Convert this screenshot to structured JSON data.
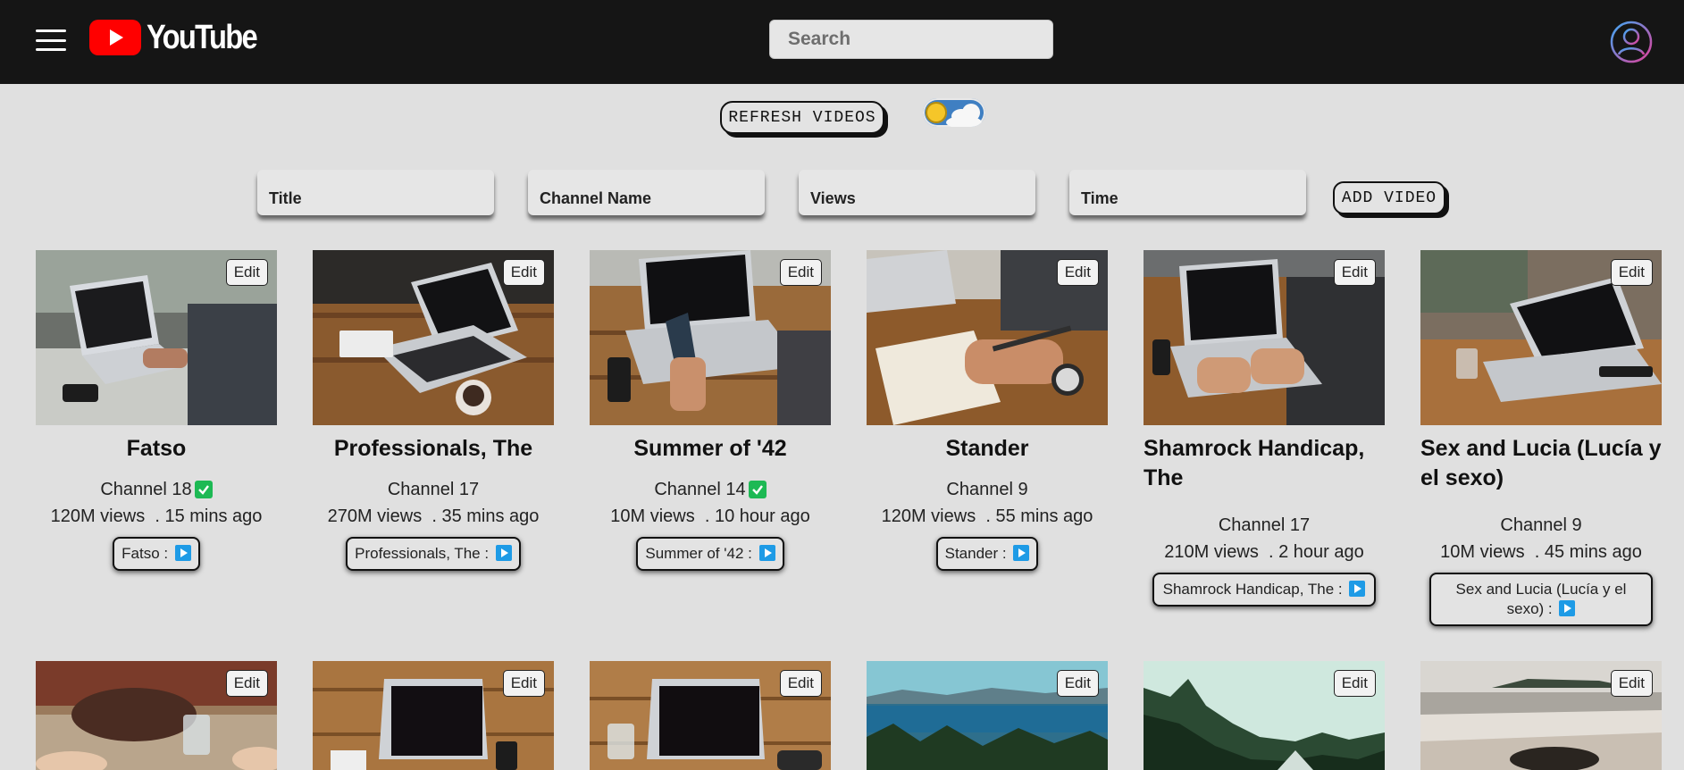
{
  "header": {
    "logo_text": "YouTube",
    "search_placeholder": "Search"
  },
  "controls": {
    "refresh_label": "REFRESH VIDEOS",
    "add_label": "ADD VIDEO",
    "fields": {
      "title_placeholder": "Title",
      "channel_placeholder": "Channel Name",
      "views_placeholder": "Views",
      "time_placeholder": "Time"
    }
  },
  "colors": {
    "topbar": "#151515",
    "background": "#e0e0e0",
    "brand_red": "#ff0000",
    "verified_green": "#1db954",
    "play_blue": "#1e9be6"
  },
  "videos": [
    {
      "title": "Fatso",
      "channel": "Channel 18",
      "verified": true,
      "views": "120M views",
      "time": ". 15 mins ago",
      "play_label": "Fatso :",
      "edit": "Edit"
    },
    {
      "title": "Professionals, The",
      "channel": "Channel 17",
      "verified": false,
      "views": "270M views",
      "time": ". 35 mins ago",
      "play_label": "Professionals, The :",
      "edit": "Edit"
    },
    {
      "title": "Summer of '42",
      "channel": "Channel 14",
      "verified": true,
      "views": "10M views",
      "time": ". 10 hour ago",
      "play_label": "Summer of '42 :",
      "edit": "Edit"
    },
    {
      "title": "Stander",
      "channel": "Channel 9",
      "verified": false,
      "views": "120M views",
      "time": ". 55 mins ago",
      "play_label": "Stander :",
      "edit": "Edit"
    },
    {
      "title": "Shamrock Handicap, The",
      "channel": "Channel 17",
      "verified": false,
      "views": "210M views",
      "time": ". 2 hour ago",
      "play_label": "Shamrock Handicap, The :",
      "edit": "Edit"
    },
    {
      "title": "Sex and Lucia (Lucía y el sexo)",
      "channel": "Channel 9",
      "verified": false,
      "views": "10M views",
      "time": ". 45 mins ago",
      "play_label": "Sex and Lucia (Lucía y el sexo) :",
      "edit": "Edit"
    }
  ],
  "second_row": [
    {
      "edit": "Edit"
    },
    {
      "edit": "Edit"
    },
    {
      "edit": "Edit"
    },
    {
      "edit": "Edit"
    },
    {
      "edit": "Edit"
    },
    {
      "edit": "Edit"
    }
  ]
}
